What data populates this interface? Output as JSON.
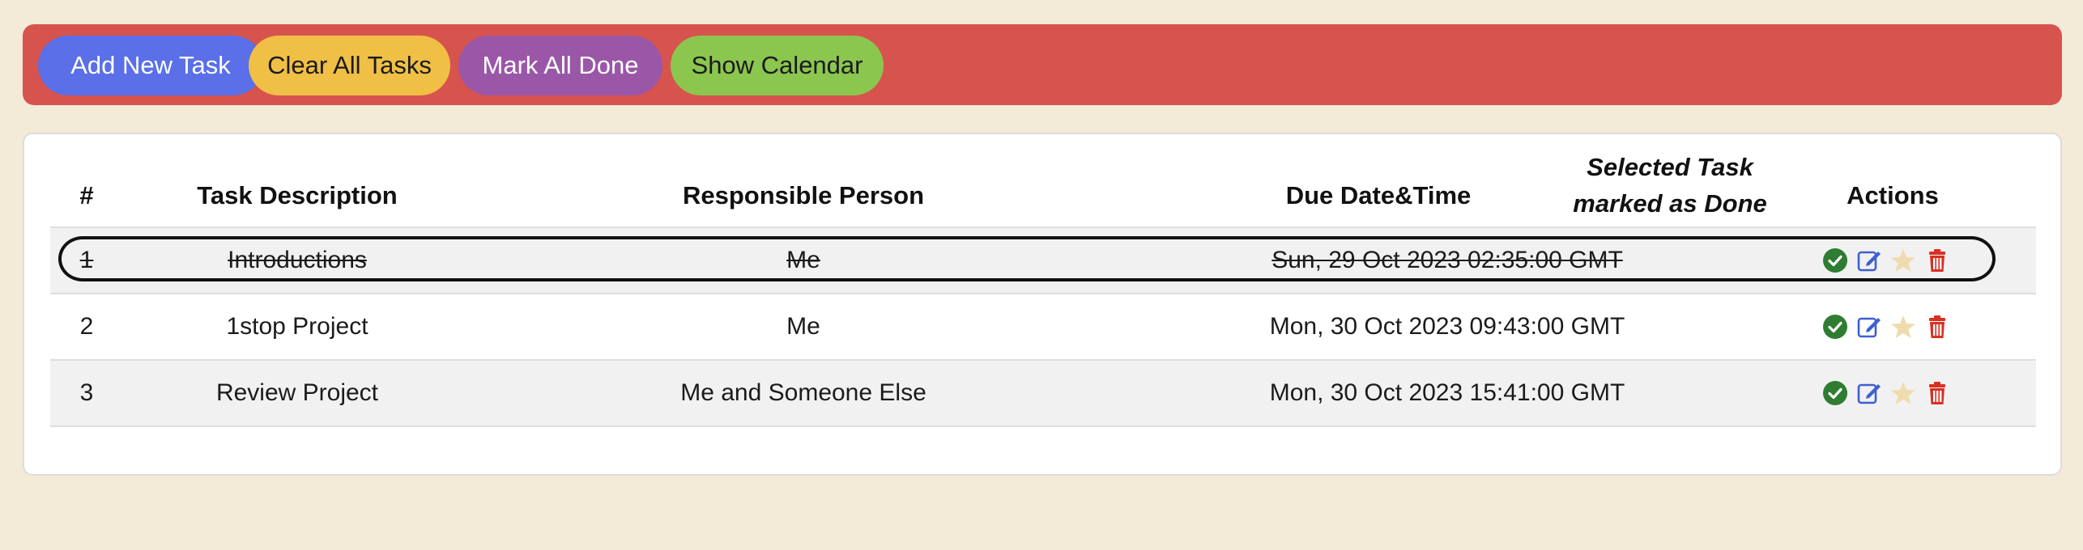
{
  "toolbar": {
    "add_label": "Add New Task",
    "clear_label": "Clear All Tasks",
    "mark_label": "Mark All Done",
    "calendar_label": "Show Calendar"
  },
  "table": {
    "headers": {
      "num": "#",
      "description": "Task Description",
      "person": "Responsible Person",
      "due": "Due Date&Time",
      "selected_line1": "Selected Task",
      "selected_line2": "marked as Done",
      "actions": "Actions"
    },
    "rows": [
      {
        "num": "1",
        "description": "Introductions",
        "person": "Me",
        "due": "Sun, 29 Oct 2023 02:35:00 GMT",
        "done": true
      },
      {
        "num": "2",
        "description": "1stop Project",
        "person": "Me",
        "due": "Mon, 30 Oct 2023 09:43:00 GMT",
        "done": false
      },
      {
        "num": "3",
        "description": "Review Project",
        "person": "Me and Someone Else",
        "due": "Mon, 30 Oct 2023 15:41:00 GMT",
        "done": false
      }
    ]
  },
  "icons": {
    "done": "check-circle-icon",
    "edit": "edit-icon",
    "star": "star-icon",
    "delete": "trash-icon"
  },
  "colors": {
    "toolbar_bg": "#d7534d",
    "add_btn": "#5a6fe8",
    "clear_btn": "#f0bf45",
    "mark_btn": "#9a57a8",
    "calendar_btn": "#8bc64f",
    "check_icon": "#2f7d32",
    "edit_icon": "#3d5fd1",
    "star_icon": "#efdcae",
    "trash_icon": "#d93023"
  }
}
